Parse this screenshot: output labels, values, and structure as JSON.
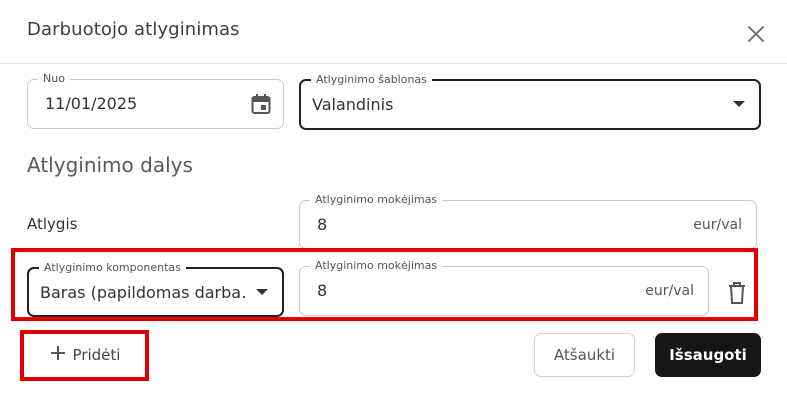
{
  "dialog": {
    "title": "Darbuotojo atlyginimas"
  },
  "form": {
    "from": {
      "label": "Nuo",
      "value": "11/01/2025"
    },
    "template": {
      "label": "Atlyginimo šablonas",
      "value": "Valandinis"
    }
  },
  "parts": {
    "section_title": "Atlyginimo dalys",
    "rows": [
      {
        "label": "Atlygis",
        "payment_label": "Atlyginimo mokėjimas",
        "payment_value": "8",
        "unit": "eur/val"
      },
      {
        "component_label": "Atlyginimo komponentas",
        "component_value": "Baras (papildomas darba…",
        "payment_label": "Atlyginimo mokėjimas",
        "payment_value": "8",
        "unit": "eur/val"
      }
    ]
  },
  "actions": {
    "add_label": "Pridėti",
    "cancel_label": "Atšaukti",
    "save_label": "Išsaugoti"
  },
  "colors": {
    "highlight": "#e00000",
    "primary": "#161616"
  }
}
